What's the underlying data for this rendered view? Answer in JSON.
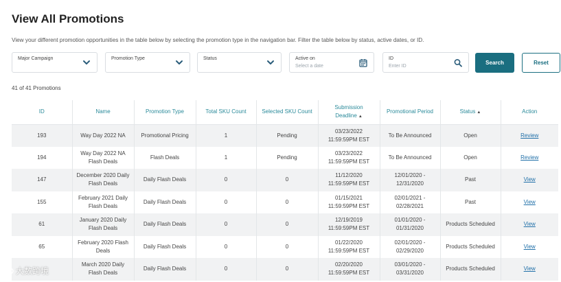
{
  "page": {
    "title": "View All Promotions",
    "description": "View your different promotion opportunities in the table below by selecting the promotion type in the navigation bar. Filter the table below by status, active dates, or ID."
  },
  "filters": {
    "major_campaign": {
      "label": "Major Campaign",
      "icon": "chevron-down-icon"
    },
    "promotion_type": {
      "label": "Promotion Type",
      "icon": "chevron-down-icon"
    },
    "status": {
      "label": "Status",
      "icon": "chevron-down-icon"
    },
    "active_on": {
      "label": "Active on",
      "placeholder": "Select a date",
      "icon": "calendar-icon"
    },
    "id": {
      "label": "ID",
      "placeholder": "Enter ID",
      "icon": "search-icon"
    },
    "search_label": "Search",
    "reset_label": "Reset"
  },
  "result_count": "41 of 41 Promotions",
  "table": {
    "headers": [
      "ID",
      "Name",
      "Promotion Type",
      "Total SKU Count",
      "Selected SKU Count",
      "Submission Deadline",
      "Promotional Period",
      "Status",
      "Action"
    ],
    "sorted_indicators": {
      "submission_deadline": "▲",
      "status": "▲"
    },
    "rows": [
      {
        "id": "193",
        "name": "Way Day 2022 NA",
        "type": "Promotional Pricing",
        "total": "1",
        "selected": "Pending",
        "deadline": "03/23/2022 11:59:59PM EST",
        "period": "To Be Announced",
        "status": "Open",
        "action": "Review"
      },
      {
        "id": "194",
        "name": "Way Day 2022 NA Flash Deals",
        "type": "Flash Deals",
        "total": "1",
        "selected": "Pending",
        "deadline": "03/23/2022 11:59:59PM EST",
        "period": "To Be Announced",
        "status": "Open",
        "action": "Review"
      },
      {
        "id": "147",
        "name": "December 2020 Daily Flash Deals",
        "type": "Daily Flash Deals",
        "total": "0",
        "selected": "0",
        "deadline": "11/12/2020 11:59:59PM EST",
        "period": "12/01/2020 - 12/31/2020",
        "status": "Past",
        "action": "View"
      },
      {
        "id": "155",
        "name": "February 2021 Daily Flash Deals",
        "type": "Daily Flash Deals",
        "total": "0",
        "selected": "0",
        "deadline": "01/15/2021 11:59:59PM EST",
        "period": "02/01/2021 - 02/28/2021",
        "status": "Past",
        "action": "View"
      },
      {
        "id": "61",
        "name": "January 2020 Daily Flash Deals",
        "type": "Daily Flash Deals",
        "total": "0",
        "selected": "0",
        "deadline": "12/19/2019 11:59:59PM EST",
        "period": "01/01/2020 - 01/31/2020",
        "status": "Products Scheduled",
        "action": "View"
      },
      {
        "id": "65",
        "name": "February 2020 Flash Deals",
        "type": "Daily Flash Deals",
        "total": "0",
        "selected": "0",
        "deadline": "01/22/2020 11:59:59PM EST",
        "period": "02/01/2020 - 02/29/2020",
        "status": "Products Scheduled",
        "action": "View"
      },
      {
        "id": "",
        "name": "March 2020 Daily Flash Deals",
        "type": "Daily Flash Deals",
        "total": "0",
        "selected": "0",
        "deadline": "02/20/2020 11:59:59PM EST",
        "period": "03/01/2020 - 03/31/2020",
        "status": "Products Scheduled",
        "action": "View"
      }
    ]
  },
  "watermark": {
    "text": "大数跨境"
  },
  "colors": {
    "accent": "#1a6e80",
    "header_text": "#2a8a9a",
    "link": "#1f6fa8",
    "stripe": "#f1f2f3"
  }
}
